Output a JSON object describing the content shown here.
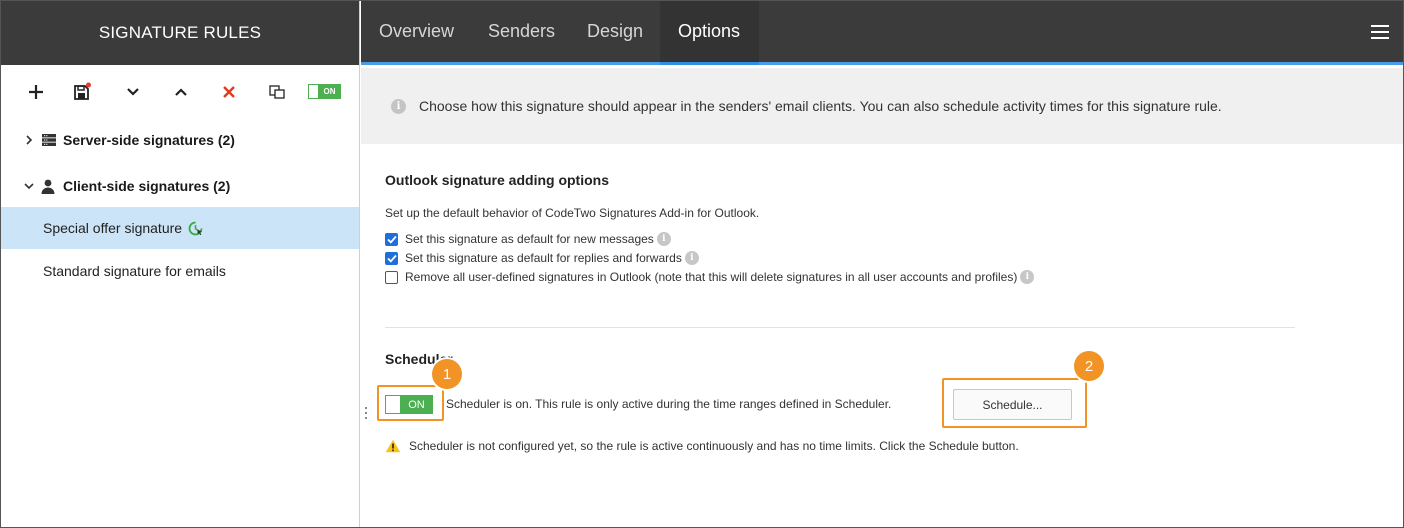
{
  "sidebar": {
    "title": "SIGNATURE RULES",
    "toolbar": {
      "toggle_label": "ON"
    },
    "groups": [
      {
        "label": "Server-side signatures (2)",
        "expanded": false,
        "icon": "server-icon"
      },
      {
        "label": "Client-side signatures (2)",
        "expanded": true,
        "icon": "user-icon"
      }
    ],
    "items": [
      {
        "label": "Special offer signature",
        "selected": true,
        "status_icon": "scheduled-active-icon"
      },
      {
        "label": "Standard signature for emails",
        "selected": false
      }
    ]
  },
  "tabs": [
    {
      "label": "Overview",
      "active": false
    },
    {
      "label": "Senders",
      "active": false
    },
    {
      "label": "Design",
      "active": false
    },
    {
      "label": "Options",
      "active": true
    }
  ],
  "info_bar": {
    "text": "Choose how this signature should appear in the senders' email clients. You can also schedule activity times for this signature rule."
  },
  "outlook": {
    "title": "Outlook signature adding options",
    "description": "Set up the default behavior of CodeTwo Signatures Add-in for Outlook.",
    "options": [
      {
        "label": "Set this signature as default for new messages",
        "checked": true
      },
      {
        "label": "Set this signature as default for replies and forwards",
        "checked": true
      },
      {
        "label": "Remove all user-defined signatures in Outlook (note that this will delete signatures in all user accounts and profiles)",
        "checked": false
      }
    ]
  },
  "scheduler": {
    "title": "Scheduler",
    "toggle_label": "ON",
    "status_text": "Scheduler is on. This rule is only active during the time ranges defined in Scheduler.",
    "button_label": "Schedule...",
    "warning_text": "Scheduler is not configured yet, so the rule is active continuously and has no time limits. Click the Schedule button."
  },
  "callouts": {
    "first": "1",
    "second": "2"
  },
  "colors": {
    "header_bg": "#3b3b3b",
    "accent_blue": "#2e8fe6",
    "selected_bg": "#cce4f7",
    "toggle_green": "#4caf50",
    "callout_orange": "#f29325",
    "delete_red": "#e03a1e"
  }
}
